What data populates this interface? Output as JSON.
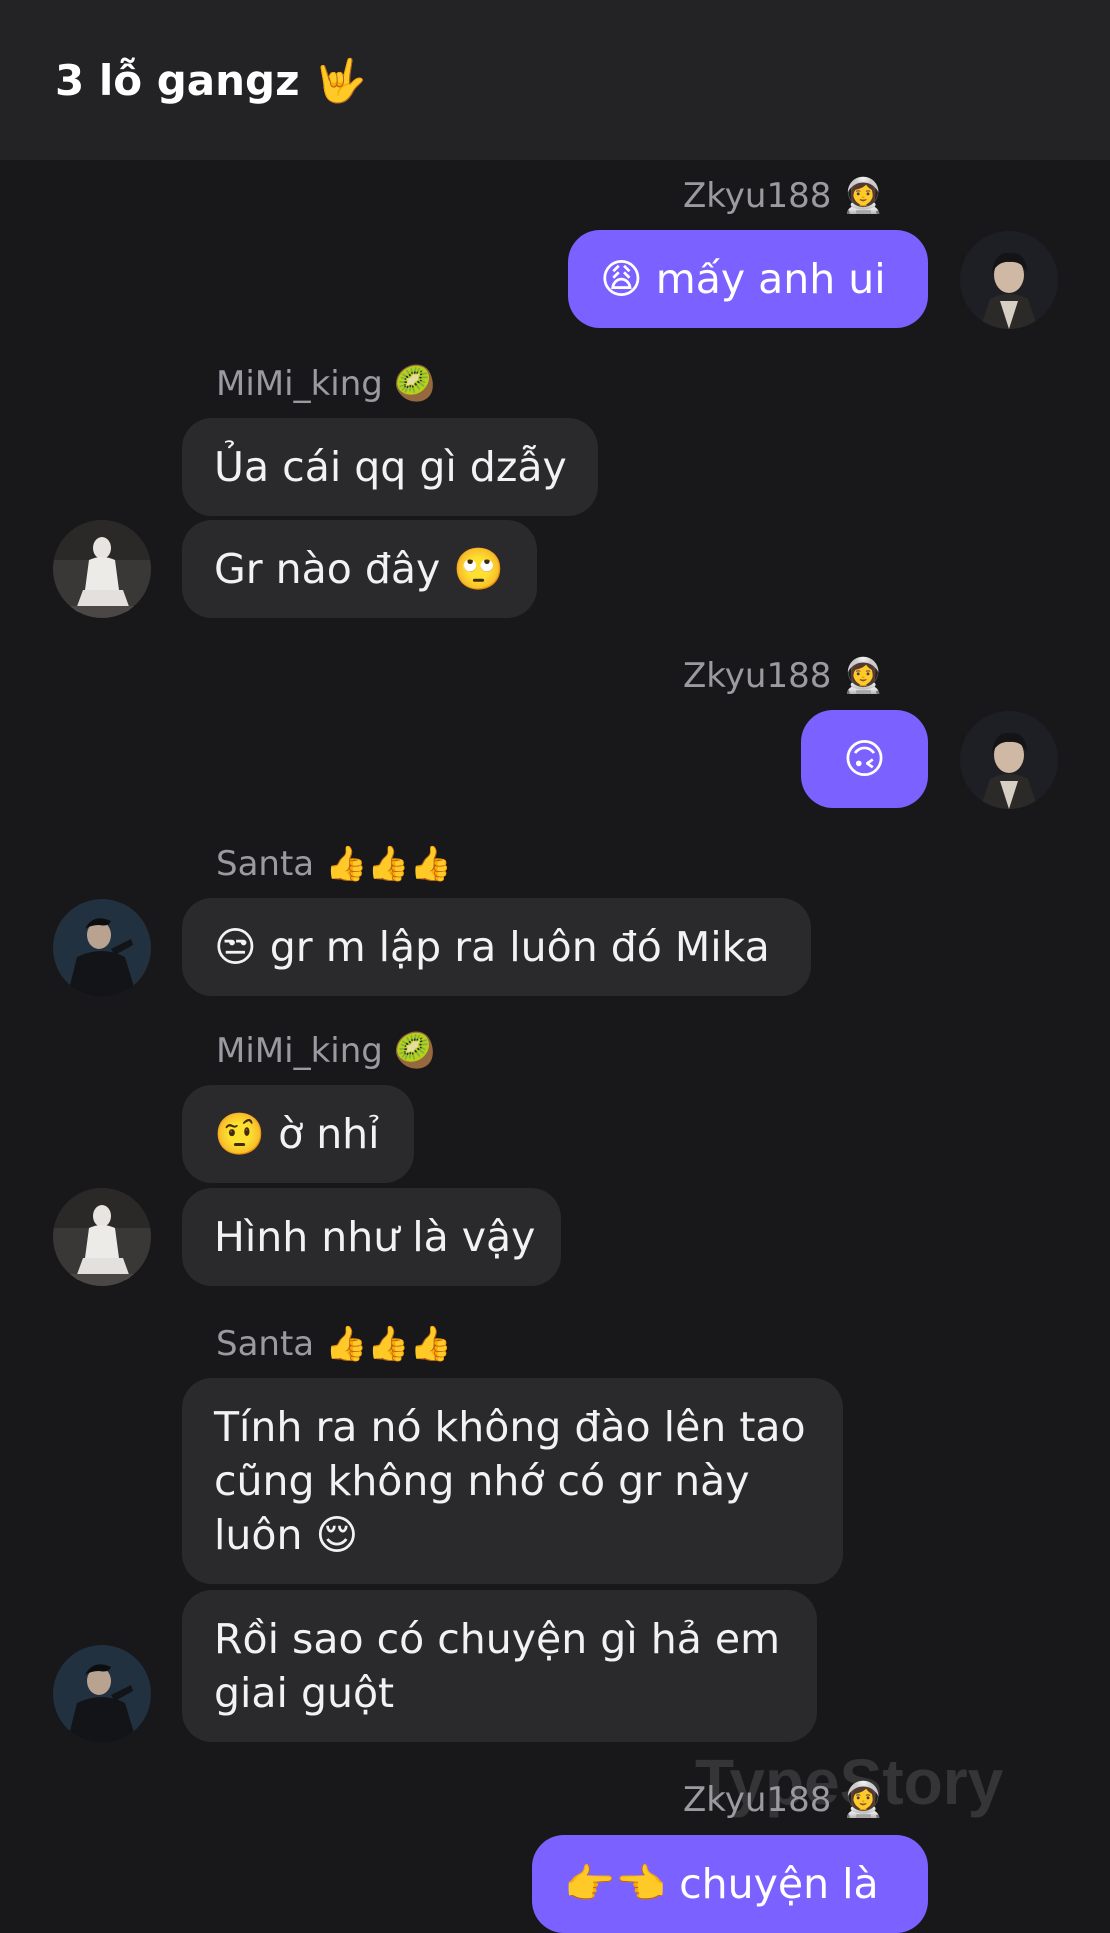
{
  "header": {
    "title": "3 lỗ gangz 🤟"
  },
  "watermark": "TypeStory",
  "messages": [
    {
      "sender": "Zkyu188 👩‍🚀",
      "text": "😩 mấy anh ui"
    },
    {
      "sender": "MiMi_king 🥝",
      "text": "Ủa cái qq gì dzẫy"
    },
    {
      "text": "Gr nào đây 🙄"
    },
    {
      "sender": "Zkyu188 👩‍🚀",
      "text": "🙃"
    },
    {
      "sender": "Santa 👍👍👍",
      "text": "😒 gr m lập ra luôn đó Mika"
    },
    {
      "sender": "MiMi_king 🥝",
      "text": "🤨 ờ nhỉ"
    },
    {
      "text": "Hình như là vậy"
    },
    {
      "sender": "Santa 👍👍👍",
      "text": "Tính ra nó không đào lên tao cũng không nhớ có gr này luôn 😌"
    },
    {
      "text": "Rồi sao có chuyện gì hả em giai guột"
    },
    {
      "sender": "Zkyu188 👩‍🚀",
      "text": "👉👈 chuyện là"
    }
  ],
  "colors": {
    "background": "#18181a",
    "header": "#232325",
    "incoming": "#2a2a2d",
    "outgoing": "#7b61ff",
    "name": "#9a9aa0"
  }
}
